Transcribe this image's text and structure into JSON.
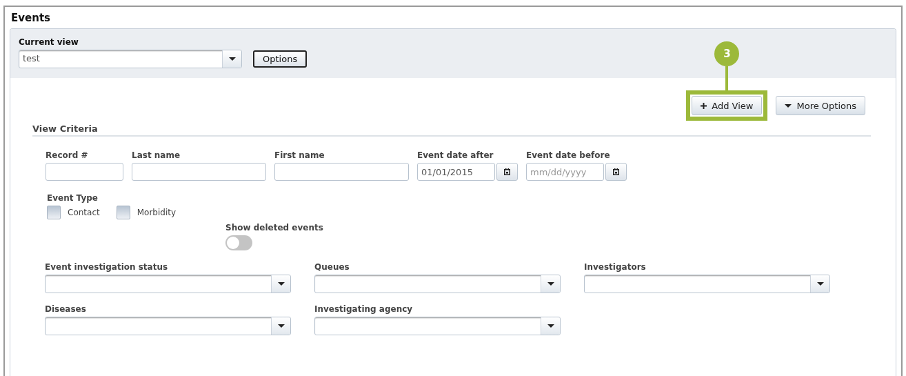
{
  "page": {
    "title": "Events"
  },
  "current_view": {
    "label": "Current view",
    "value": "test",
    "options_button": "Options"
  },
  "callout": {
    "number": "3"
  },
  "actions": [
    {
      "label": "Add View",
      "kind": "add",
      "highlighted": true
    },
    {
      "label": "More Options",
      "kind": "menu",
      "highlighted": false
    }
  ],
  "criteria": {
    "title": "View Criteria",
    "fields": [
      {
        "label": "Record #",
        "kind": "number"
      },
      {
        "label": "Last name",
        "kind": "text"
      },
      {
        "label": "First name",
        "kind": "text"
      },
      {
        "label": "Event date after",
        "kind": "date",
        "value": "01/01/2015"
      },
      {
        "label": "Event date before",
        "kind": "date",
        "placeholder": "mm/dd/yyyy"
      }
    ],
    "event_type": {
      "label": "Event Type",
      "options": [
        {
          "label": "Contact",
          "checked": false
        },
        {
          "label": "Morbidity",
          "checked": false
        }
      ]
    },
    "show_deleted": {
      "label": "Show deleted events",
      "on": false
    },
    "selects": [
      {
        "label": "Event investigation status"
      },
      {
        "label": "Queues"
      },
      {
        "label": "Investigators"
      },
      {
        "label": "Diseases"
      },
      {
        "label": "Investigating agency"
      }
    ]
  }
}
